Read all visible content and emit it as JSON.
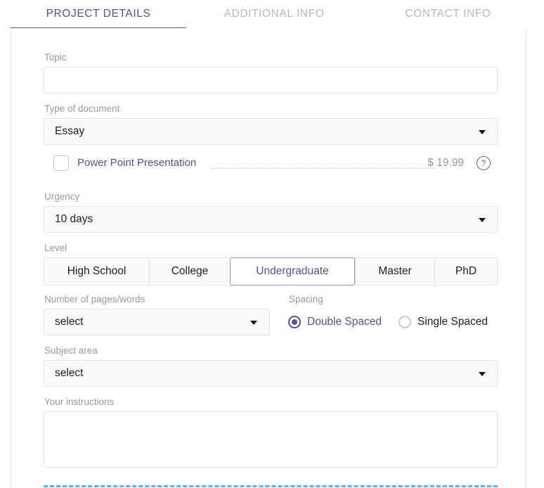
{
  "tabs": [
    {
      "label": "PROJECT DETAILS",
      "active": true
    },
    {
      "label": "ADDITIONAL INFO",
      "active": false
    },
    {
      "label": "CONTACT INFO",
      "active": false
    }
  ],
  "form": {
    "topic": {
      "label": "Topic",
      "value": "",
      "placeholder": ""
    },
    "type_of_document": {
      "label": "Type of document",
      "value": "Essay"
    },
    "power_point": {
      "label": "Power Point Presentation",
      "checked": false,
      "price": "$ 19.99",
      "help": "?"
    },
    "urgency": {
      "label": "Urgency",
      "value": "10 days"
    },
    "level": {
      "label": "Level",
      "options": [
        {
          "label": "High School",
          "selected": false
        },
        {
          "label": "College",
          "selected": false
        },
        {
          "label": "Undergraduate",
          "selected": true
        },
        {
          "label": "Master",
          "selected": false
        },
        {
          "label": "PhD",
          "selected": false
        }
      ]
    },
    "pages": {
      "label": "Number of pages/words",
      "value": "select"
    },
    "spacing": {
      "label": "Spacing",
      "options": [
        {
          "label": "Double Spaced",
          "selected": true
        },
        {
          "label": "Single Spaced",
          "selected": false
        }
      ]
    },
    "subject_area": {
      "label": "Subject area",
      "value": "select"
    },
    "instructions": {
      "label": "Your instructions",
      "value": "",
      "placeholder": ""
    }
  },
  "colors": {
    "accent": "#5c4e93",
    "accent_light": "#9a8bc9",
    "label_gray": "#9a9a9e",
    "border": "#e3e3e5",
    "dropzone_blue": "#5bb3ef"
  }
}
